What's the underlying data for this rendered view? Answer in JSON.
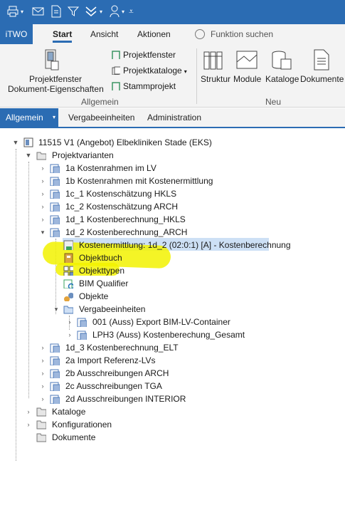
{
  "ribbon": {
    "tabs": [
      "iTWO",
      "Start",
      "Ansicht",
      "Aktionen"
    ],
    "search_placeholder": "Funktion suchen",
    "projektfenster_big": "Projektfenster",
    "dokument_eigenschaften": "Dokument-Eigenschaften",
    "projektfenster_small": "Projektfenster",
    "projektkataloge": "Projektkataloge",
    "stammprojekt": "Stammprojekt",
    "group_allgemein": "Allgemein",
    "struktur": "Struktur",
    "module": "Module",
    "kataloge": "Kataloge",
    "dokumente": "Dokumente",
    "group_neu": "Neu"
  },
  "nav_tabs": [
    "Allgemein",
    "Vergabeeinheiten",
    "Administration"
  ],
  "tree": {
    "root": "11515 V1 (Angebot) Elbekliniken Stade (EKS)",
    "projektvarianten": "Projektvarianten",
    "v1a": "1a Kostenrahmen im LV",
    "v1b": "1b Kostenrahmen mit Kostenermittlung",
    "v1c1": "1c_1 Kostenschätzung HKLS",
    "v1c2": "1c_2 Kostenschätzung ARCH",
    "v1d1": "1d_1 Kostenberechnung_HKLS",
    "v1d2": "1d_2 Kostenberechnung_ARCH",
    "kostenermittlung": "Kostenermittlung: 1d_2 (02:0:1) [A]  - Kostenberechnung",
    "objektbuch": "Objektbuch",
    "objekttypen": "Objekttypen",
    "bim": "BIM Qualifier",
    "objekte": "Objekte",
    "vergabe": "Vergabeeinheiten",
    "ve001": "001 (Auss) Export BIM-LV-Container",
    "velph3": "LPH3 (Auss) Kostenberechung_Gesamt",
    "v1d3": "1d_3 Kostenberechnung_ELT",
    "v2a": "2a Import Referenz-LVs",
    "v2b": "2b Ausschreibungen ARCH",
    "v2c": "2c Ausschreibungen TGA",
    "v2d": "2d Ausschreibungen INTERIOR",
    "kataloge": "Kataloge",
    "konfigurationen": "Konfigurationen",
    "dokumente": "Dokumente"
  },
  "colors": {
    "accent": "#2b6cb3",
    "highlight": "#f2f200",
    "selection": "#cde0f5"
  }
}
